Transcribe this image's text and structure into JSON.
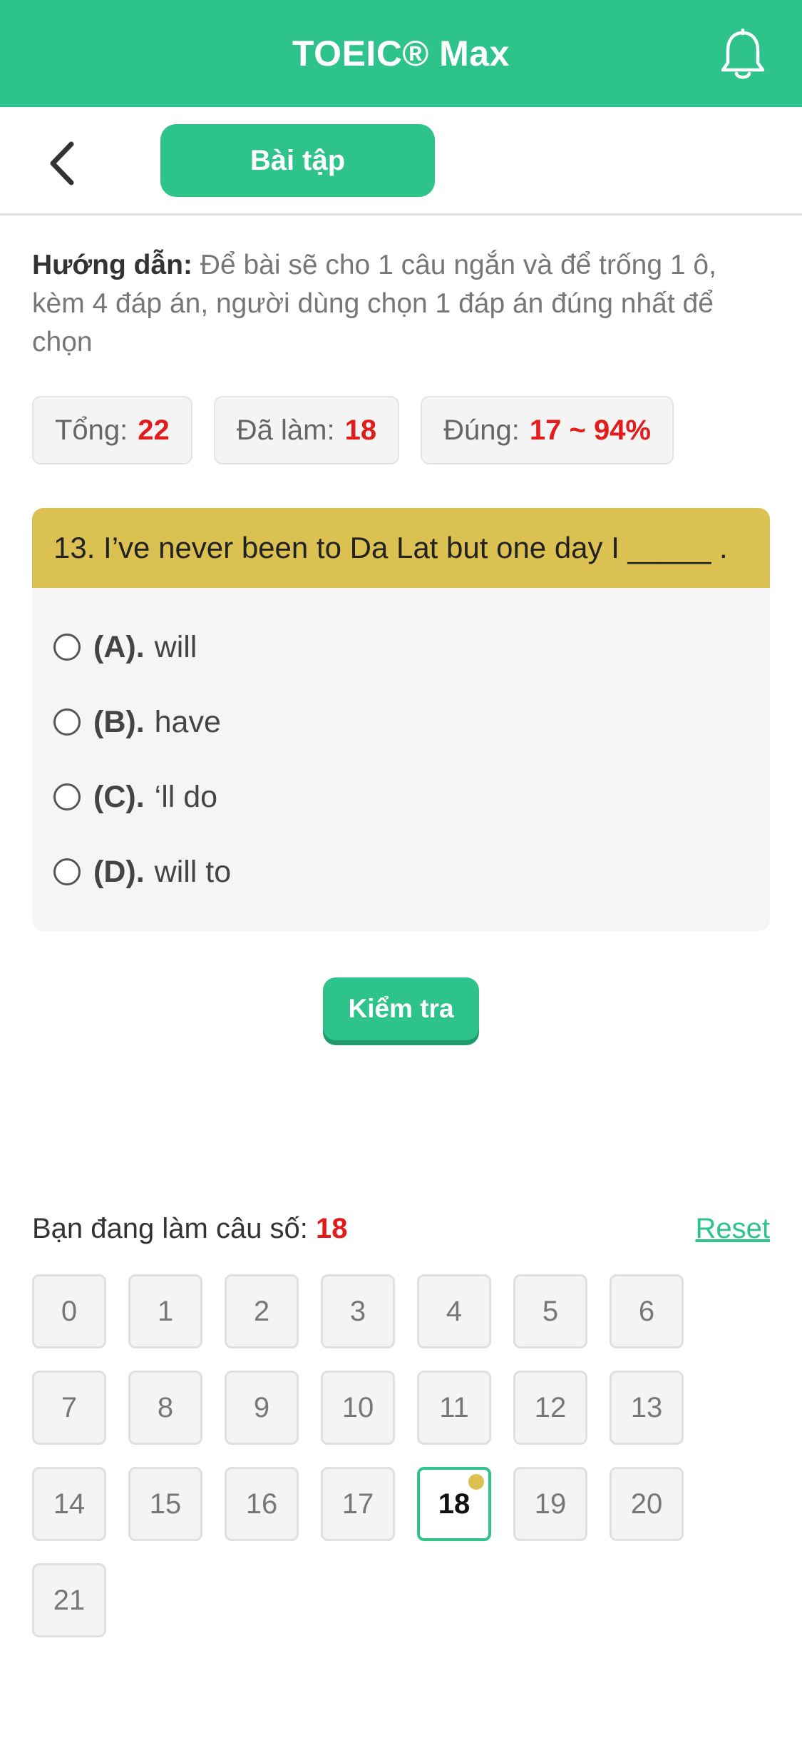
{
  "header": {
    "title": "TOEIC® Max",
    "icon": "bell-icon"
  },
  "nav": {
    "back_icon": "chevron-left-icon",
    "tab_label": "Bài tập"
  },
  "instructions": {
    "label": "Hướng dẫn:",
    "text": " Để bài sẽ cho 1 câu ngắn và để trống 1 ô, kèm 4 đáp án, người dùng chọn 1 đáp án đúng nhất để chọn"
  },
  "stats": [
    {
      "label": "Tổng:",
      "value": "22"
    },
    {
      "label": "Đã làm:",
      "value": "18"
    },
    {
      "label": "Đúng:",
      "value": "17 ~ 94%"
    }
  ],
  "question": {
    "text": "13. I’ve never been to Da Lat but one day I _____ .",
    "options": [
      {
        "letter": "(A).",
        "text": "will"
      },
      {
        "letter": "(B).",
        "text": "have"
      },
      {
        "letter": "(C).",
        "text": "‘ll do"
      },
      {
        "letter": "(D).",
        "text": "will to"
      }
    ]
  },
  "check_button": "Kiểm tra",
  "progress": {
    "label": "Bạn đang làm câu số:",
    "current": "18",
    "reset": "Reset"
  },
  "grid": [
    "0",
    "1",
    "2",
    "3",
    "4",
    "5",
    "6",
    "7",
    "8",
    "9",
    "10",
    "11",
    "12",
    "13",
    "14",
    "15",
    "16",
    "17",
    "18",
    "19",
    "20",
    "21"
  ],
  "colors": {
    "accent": "#2dc38a",
    "question_header": "#dbc152",
    "value_red": "#e21b1b"
  }
}
